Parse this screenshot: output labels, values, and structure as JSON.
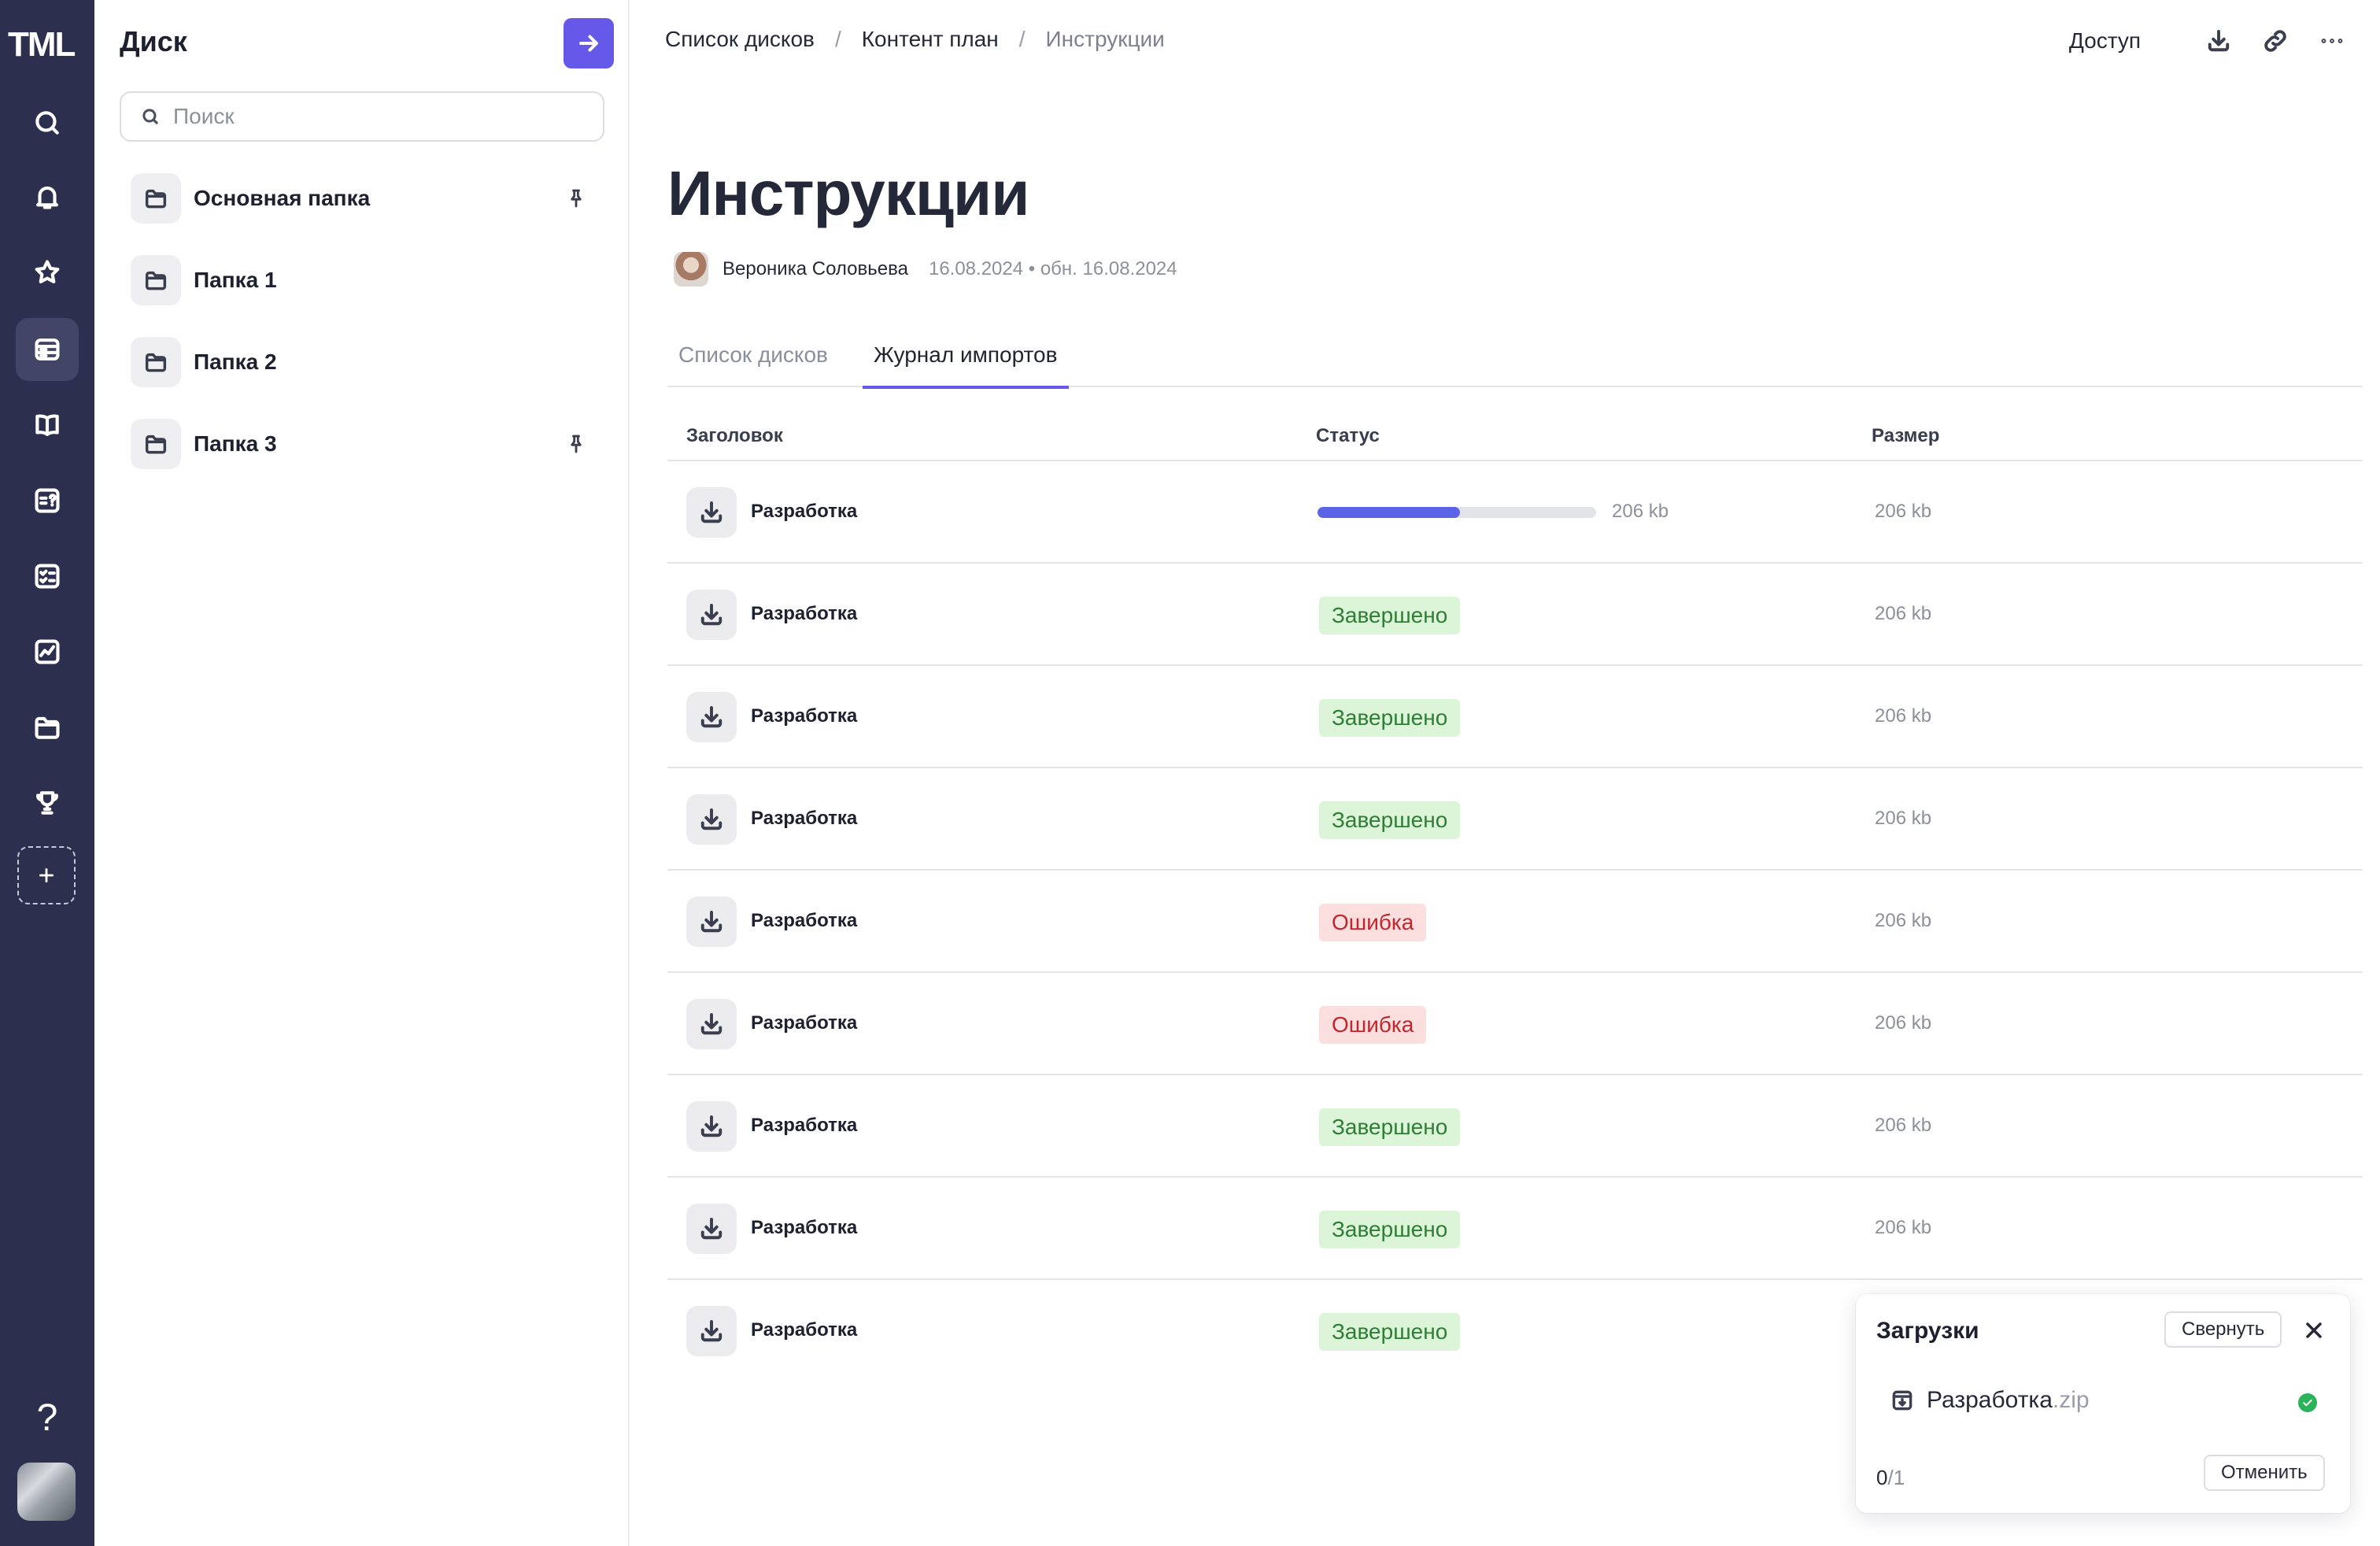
{
  "rail": {
    "logo": "TML",
    "help": "?"
  },
  "panel": {
    "title": "Диск",
    "search_placeholder": "Поиск",
    "folders": [
      {
        "label": "Основная папка",
        "pinned": true
      },
      {
        "label": "Папка 1",
        "pinned": false
      },
      {
        "label": "Папка 2",
        "pinned": false
      },
      {
        "label": "Папка 3",
        "pinned": true
      }
    ]
  },
  "breadcrumb": [
    "Список дисков",
    "Контент план",
    "Инструкции"
  ],
  "top": {
    "access": "Доступ"
  },
  "page": {
    "title": "Инструкции",
    "author": "Вероника Соловьева",
    "dates": "16.08.2024 • обн. 16.08.2024"
  },
  "tabs": [
    {
      "label": "Список дисков",
      "active": false
    },
    {
      "label": "Журнал импортов",
      "active": true
    }
  ],
  "table": {
    "headers": {
      "title": "Заголовок",
      "status": "Статус",
      "size": "Размер"
    },
    "rows": [
      {
        "title": "Разработка",
        "status": "progress",
        "progress": 0.51,
        "progress_text": "206 kb",
        "size": "206 kb"
      },
      {
        "title": "Разработка",
        "status": "Завершено",
        "kind": "ok",
        "size": "206 kb"
      },
      {
        "title": "Разработка",
        "status": "Завершено",
        "kind": "ok",
        "size": "206 kb"
      },
      {
        "title": "Разработка",
        "status": "Завершено",
        "kind": "ok",
        "size": "206 kb"
      },
      {
        "title": "Разработка",
        "status": "Ошибка",
        "kind": "err",
        "size": "206 kb"
      },
      {
        "title": "Разработка",
        "status": "Ошибка",
        "kind": "err",
        "size": "206 kb"
      },
      {
        "title": "Разработка",
        "status": "Завершено",
        "kind": "ok",
        "size": "206 kb"
      },
      {
        "title": "Разработка",
        "status": "Завершено",
        "kind": "ok",
        "size": "206 kb"
      },
      {
        "title": "Разработка",
        "status": "Завершено",
        "kind": "ok",
        "size": ""
      }
    ]
  },
  "downloads": {
    "title": "Загрузки",
    "collapse": "Свернуть",
    "file_name": "Разработка",
    "file_ext": ".zip",
    "count_done": "0",
    "count_total": "/1",
    "cancel": "Отменить"
  },
  "colors": {
    "rail_bg": "#2d2f4f",
    "accent": "#6658e8",
    "success_bg": "#dcf5d8",
    "success_text": "#2f7d36",
    "error_bg": "#fbdede",
    "error_text": "#c2262d"
  }
}
